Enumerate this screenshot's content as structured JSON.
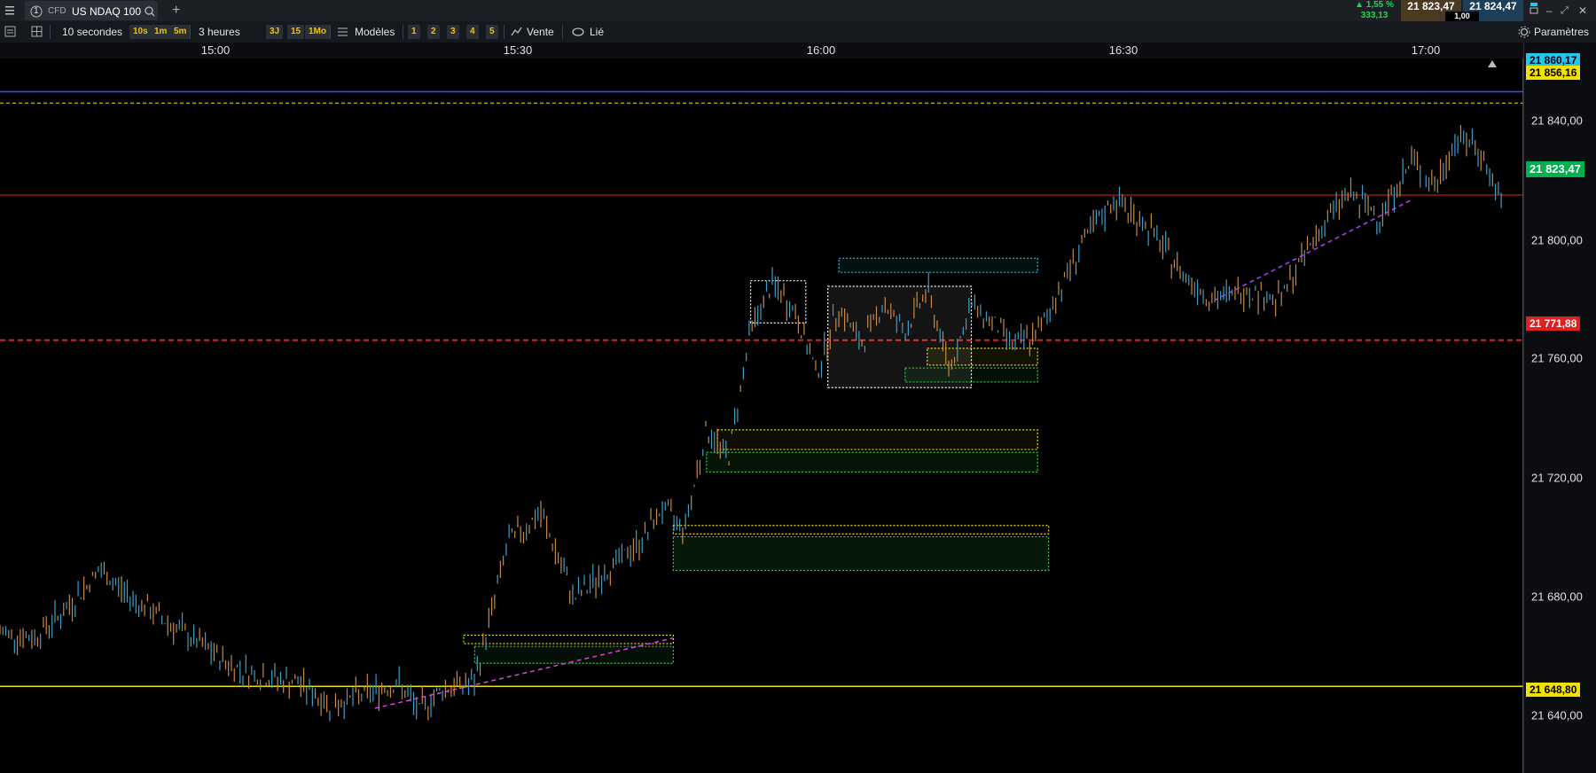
{
  "tab": {
    "index": "1",
    "badge": "CFD",
    "instrument": "US NDAQ 100"
  },
  "quotes": {
    "change_pct": "▲ 1,55 %",
    "change_abs": "333,13",
    "bid": "21 823,47",
    "ask": "21 824,47",
    "spread": "1,00"
  },
  "toolbar": {
    "interval_label": "10 secondes",
    "interval_buttons": [
      "10s",
      "1m",
      "5m"
    ],
    "range_label": "3 heures",
    "range_buttons": [
      "3J",
      "15",
      "1Mo"
    ],
    "templates_label": "Modèles",
    "preset_buttons": [
      "1",
      "2",
      "3",
      "4",
      "5"
    ],
    "sell_label": "Vente",
    "linked_label": "Lié",
    "settings_label": "Paramètres"
  },
  "time_axis": [
    "15:00",
    "15:30",
    "16:00",
    "16:30",
    "17:00"
  ],
  "price_axis": [
    "21 840,00",
    "21 800,00",
    "21 760,00",
    "21 720,00",
    "21 680,00",
    "21 640,00"
  ],
  "price_tags": {
    "top_blue": "21 860,17",
    "top_yellow": "21 856,16",
    "current": "21 823,47",
    "red_dashed": "21 771,88",
    "bottom_yellow": "21 648,80"
  },
  "colors": {
    "current_green": "#00b050",
    "red_line": "#e02020",
    "yellow_line": "#f2e000",
    "cyan_box": "#25c6e6",
    "candle_up": "#3aa0c8",
    "candle_down": "#c88a40",
    "trend_magenta": "#e040e0"
  },
  "chart_data": {
    "type": "line",
    "x_range": [
      "14:52",
      "17:10"
    ],
    "ylim": [
      21618,
      21872
    ],
    "x": [
      "14:52",
      "14:55",
      "14:58",
      "15:01",
      "15:04",
      "15:07",
      "15:10",
      "15:13",
      "15:16",
      "15:19",
      "15:22",
      "15:25",
      "15:28",
      "15:30",
      "15:32",
      "15:35",
      "15:38",
      "15:41",
      "15:44",
      "15:47",
      "15:50",
      "15:52",
      "15:54",
      "15:56",
      "15:58",
      "16:00",
      "16:02",
      "16:04",
      "16:06",
      "16:08",
      "16:10",
      "16:12",
      "16:14",
      "16:16",
      "16:18",
      "16:20",
      "16:22",
      "16:24",
      "16:26",
      "16:28",
      "16:30",
      "16:33",
      "16:36",
      "16:39",
      "16:42",
      "16:45",
      "16:48",
      "16:51",
      "16:54",
      "16:57",
      "17:00",
      "17:02",
      "17:04",
      "17:06",
      "17:08"
    ],
    "series": [
      {
        "values": [
          21668,
          21666,
          21676,
          21690,
          21680,
          21672,
          21664,
          21656,
          21652,
          21650,
          21642,
          21646,
          21650,
          21640,
          21648,
          21650,
          21700,
          21710,
          21680,
          21690,
          21700,
          21712,
          21705,
          21740,
          21730,
          21776,
          21792,
          21782,
          21760,
          21784,
          21770,
          21785,
          21775,
          21790,
          21762,
          21784,
          21778,
          21770,
          21774,
          21790,
          21806,
          21822,
          21812,
          21796,
          21786,
          21790,
          21786,
          21808,
          21824,
          21816,
          21836,
          21826,
          21844,
          21840,
          21820
        ]
      }
    ],
    "levels": [
      21860.17,
      21856.16,
      21823.47,
      21771.88,
      21648.8
    ]
  }
}
